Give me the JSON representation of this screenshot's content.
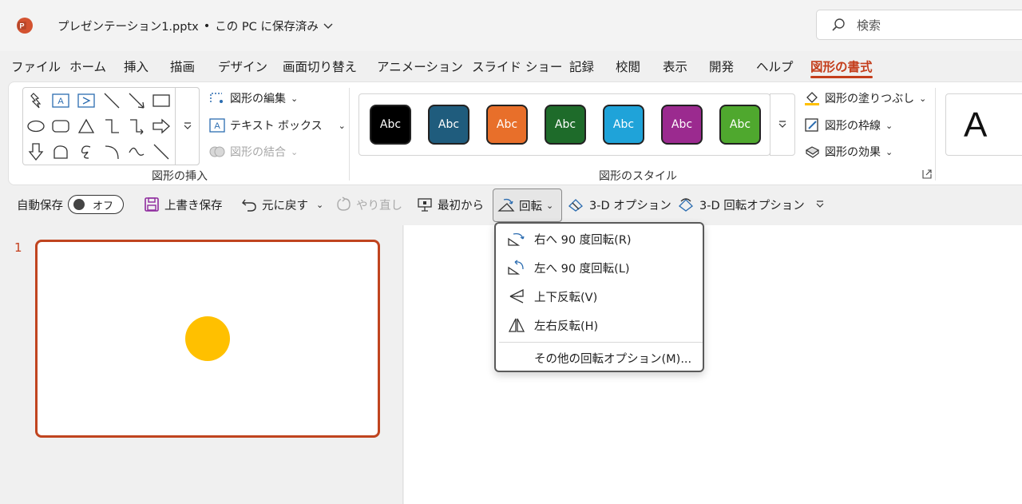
{
  "title_bar": {
    "doc_name": "プレゼンテーション1.pptx",
    "save_status": "この PC に保存済み",
    "search_placeholder": "検索"
  },
  "tabs": [
    {
      "label": "ファイル"
    },
    {
      "label": "ホーム"
    },
    {
      "label": "挿入"
    },
    {
      "label": "描画"
    },
    {
      "label": "デザイン"
    },
    {
      "label": "画面切り替え"
    },
    {
      "label": "アニメーション"
    },
    {
      "label": "スライド ショー"
    },
    {
      "label": "記録"
    },
    {
      "label": "校閲"
    },
    {
      "label": "表示"
    },
    {
      "label": "開発"
    },
    {
      "label": "ヘルプ"
    },
    {
      "label": "図形の書式",
      "active": true
    }
  ],
  "ribbon": {
    "insert_shapes": {
      "edit_shape": "図形の編集",
      "text_box": "テキスト ボックス",
      "merge_shapes": "図形の結合",
      "group_label": "図形の挿入"
    },
    "shape_styles": {
      "swatches": [
        {
          "label": "Abc",
          "color": "#000000"
        },
        {
          "label": "Abc",
          "color": "#1f5c7d"
        },
        {
          "label": "Abc",
          "color": "#e86f2a"
        },
        {
          "label": "Abc",
          "color": "#1e6b2a"
        },
        {
          "label": "Abc",
          "color": "#1fa3d9"
        },
        {
          "label": "Abc",
          "color": "#9b2a8f"
        },
        {
          "label": "Abc",
          "color": "#4fa82e"
        }
      ],
      "fill": "図形の塗りつぶし",
      "outline": "図形の枠線",
      "effects": "図形の効果",
      "group_label": "図形のスタイル"
    },
    "wordart_letter": "A"
  },
  "qat": {
    "autosave": "自動保存",
    "autosave_state": "オフ",
    "save": "上書き保存",
    "undo": "元に戻す",
    "redo": "やり直し",
    "from_beginning": "最初から",
    "rotate": "回転",
    "options_3d": "3-D オプション",
    "rotation_3d": "3-D 回転オプション"
  },
  "rotate_menu": {
    "items": [
      {
        "label": "右へ 90 度回転(R)",
        "icon": "rotate-right-icon"
      },
      {
        "label": "左へ 90 度回転(L)",
        "icon": "rotate-left-icon"
      },
      {
        "label": "上下反転(V)",
        "icon": "flip-vertical-icon"
      },
      {
        "label": "左右反転(H)",
        "icon": "flip-horizontal-icon"
      }
    ],
    "more": "その他の回転オプション(M)..."
  },
  "slides": {
    "number": "1",
    "shape_color": "#ffc000"
  },
  "accent_color": "#c43e1c"
}
